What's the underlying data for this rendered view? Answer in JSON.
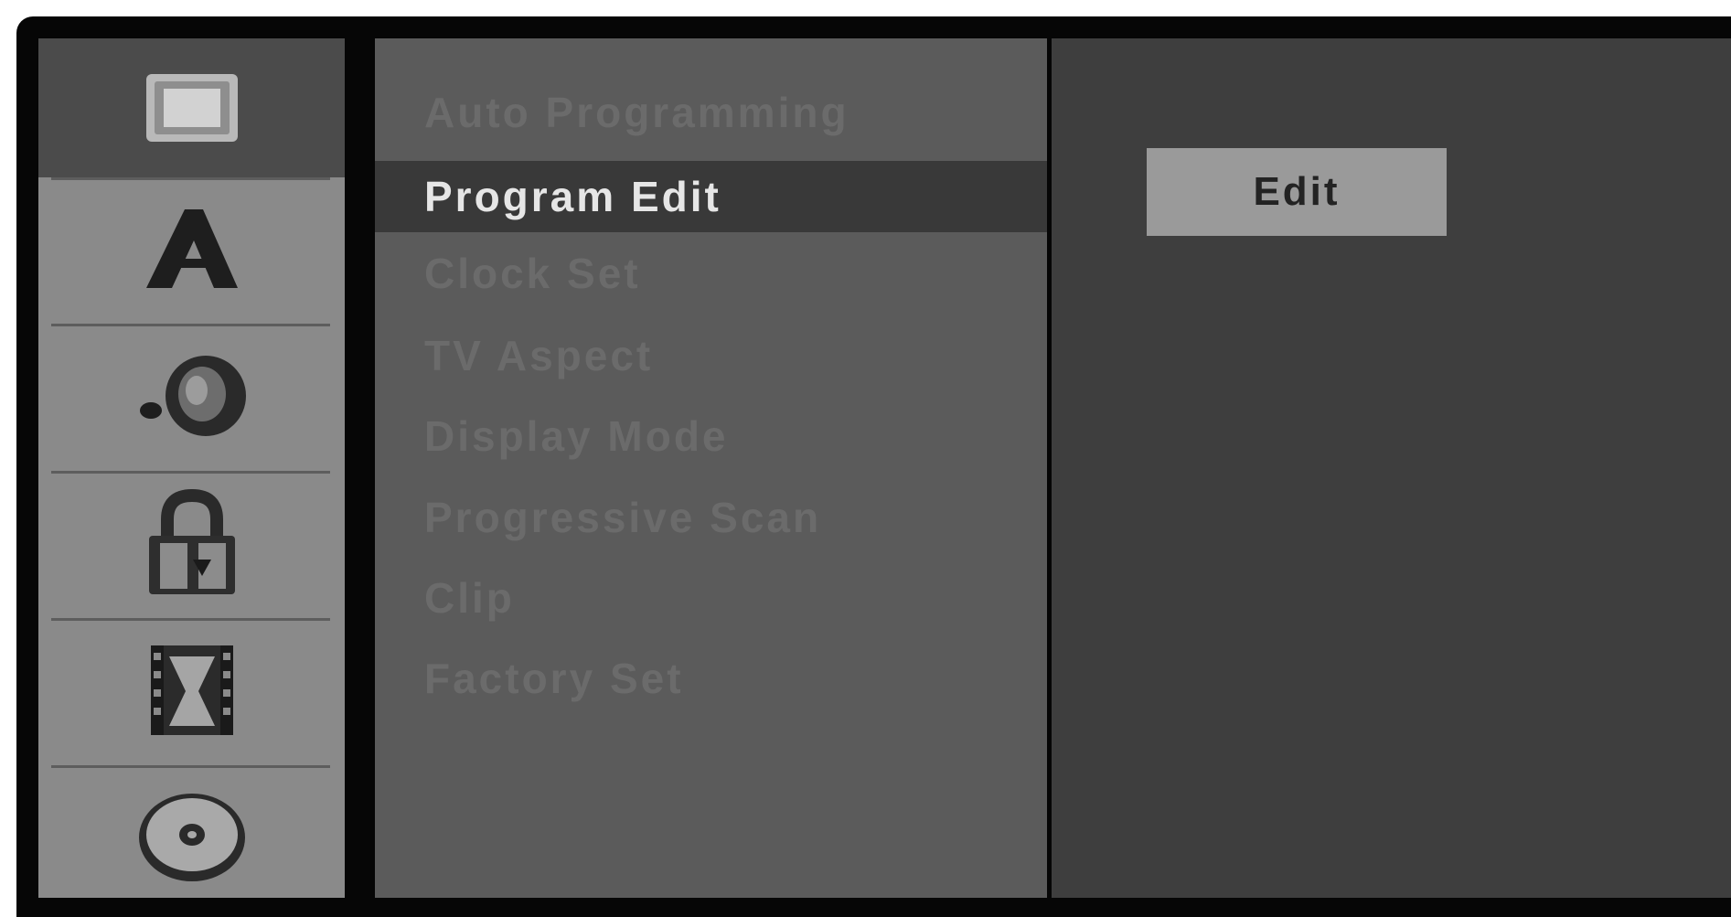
{
  "sidebar": {
    "items": [
      {
        "icon": "tv-screen-icon",
        "selected": true
      },
      {
        "icon": "language-a-icon",
        "selected": false
      },
      {
        "icon": "audio-disc-icon",
        "selected": false
      },
      {
        "icon": "lock-icon",
        "selected": false
      },
      {
        "icon": "film-icon",
        "selected": false
      },
      {
        "icon": "disc-icon",
        "selected": false
      }
    ]
  },
  "menu": {
    "items": [
      {
        "label": "Auto Programming",
        "highlighted": false
      },
      {
        "label": "Program Edit",
        "highlighted": true
      },
      {
        "label": "Clock Set",
        "highlighted": false
      },
      {
        "label": "TV Aspect",
        "highlighted": false
      },
      {
        "label": "Display Mode",
        "highlighted": false
      },
      {
        "label": "Progressive Scan",
        "highlighted": false
      },
      {
        "label": "Clip",
        "highlighted": false
      },
      {
        "label": "Factory Set",
        "highlighted": false
      }
    ]
  },
  "options": {
    "edit_label": "Edit"
  },
  "colors": {
    "sidebar_bg": "#8a8a8a",
    "sidebar_selected": "#4b4b4b",
    "menu_bg": "#5b5b5b",
    "menu_highlight": "#393939",
    "options_bg": "#3e3e3e",
    "button_bg": "#9a9a9a"
  }
}
